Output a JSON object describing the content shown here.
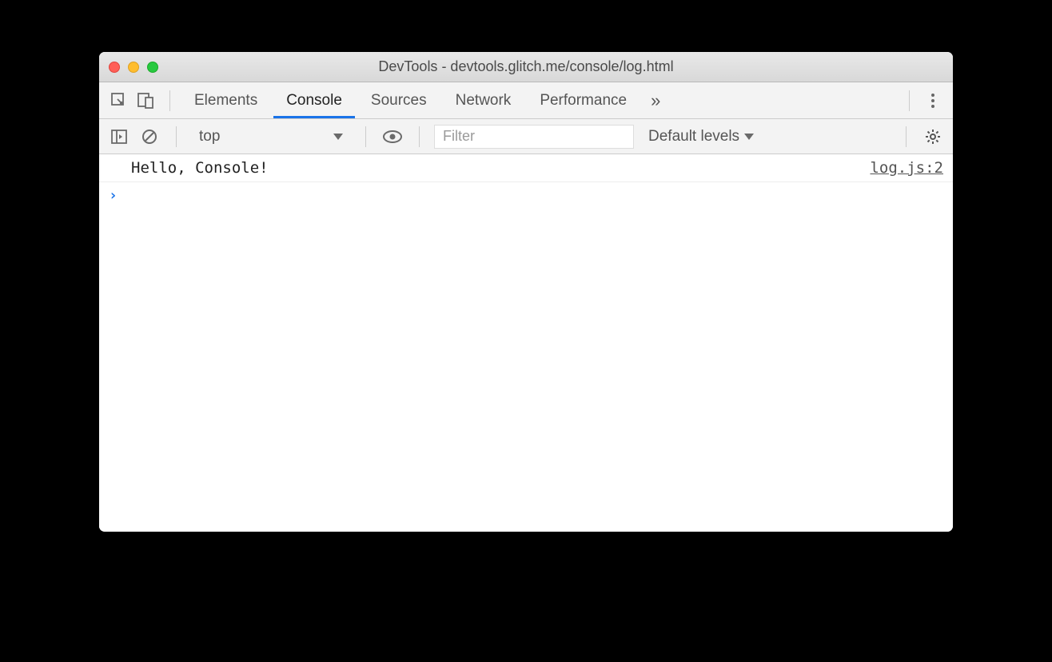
{
  "window": {
    "title": "DevTools - devtools.glitch.me/console/log.html"
  },
  "tabs": {
    "elements": "Elements",
    "console": "Console",
    "sources": "Sources",
    "network": "Network",
    "performance": "Performance"
  },
  "toolbar": {
    "context": "top",
    "filter_placeholder": "Filter",
    "levels": "Default levels"
  },
  "console": {
    "messages": [
      {
        "text": "Hello, Console!",
        "source": "log.js:2"
      }
    ],
    "prompt": ""
  }
}
